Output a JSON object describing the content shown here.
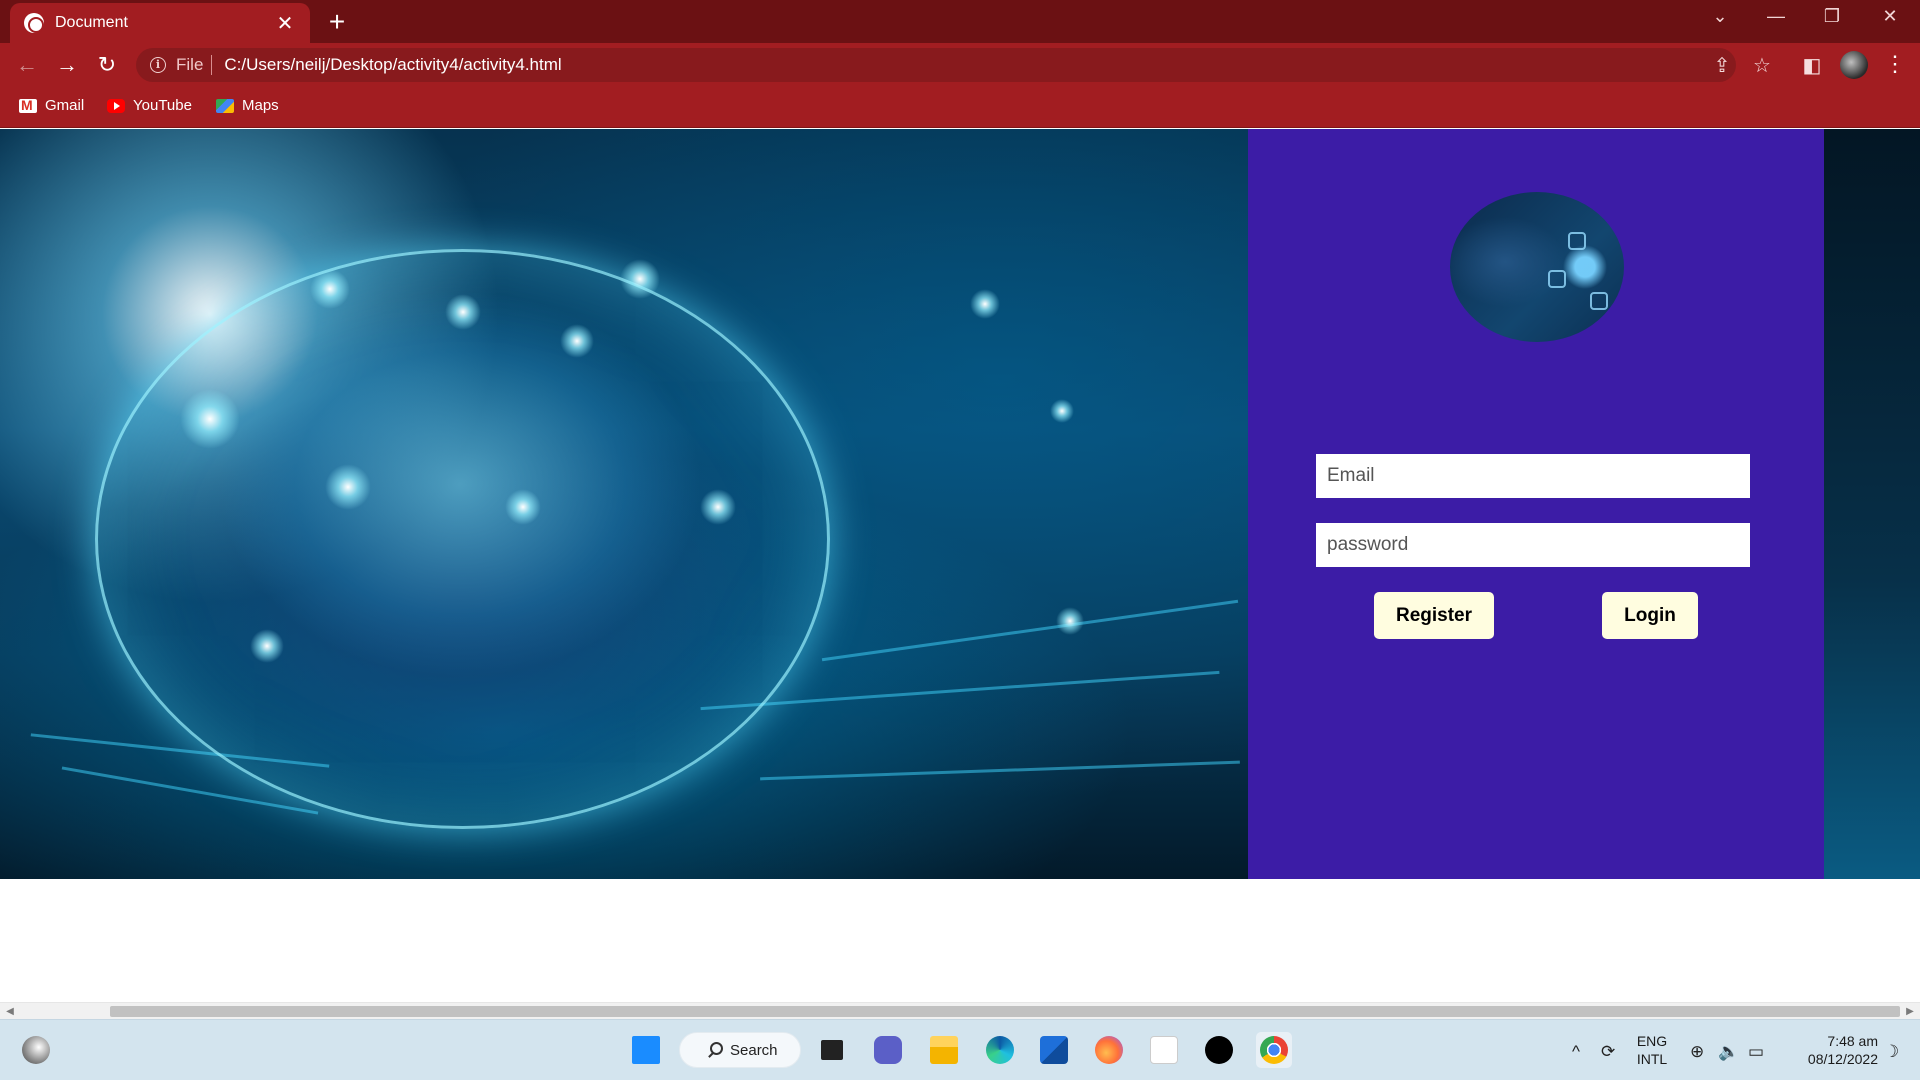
{
  "browser": {
    "tab_title": "Document",
    "tab_close": "✕",
    "new_tab": "+",
    "url_scheme": "File",
    "url": "C:/Users/neilj/Desktop/activity4/activity4.html",
    "bookmarks": [
      {
        "label": "Gmail",
        "icon": "gmail-icon"
      },
      {
        "label": "YouTube",
        "icon": "youtube-icon"
      },
      {
        "label": "Maps",
        "icon": "maps-icon"
      }
    ],
    "window_controls": {
      "tab_search": "⌄",
      "minimize": "—",
      "restore": "❐",
      "close": "✕"
    },
    "nav": {
      "back": "←",
      "forward": "→",
      "reload": "↻"
    },
    "omnibox_icons": {
      "info": "i",
      "share": "⇪",
      "star": "☆",
      "sidepanel": "◧",
      "menu": "⋮"
    }
  },
  "page": {
    "login": {
      "email_placeholder": "Email",
      "password_placeholder": "password",
      "register_label": "Register",
      "login_label": "Login"
    },
    "colors": {
      "panel": "#3c1ca6",
      "button": "#fffde0",
      "chrome": "#a21d21"
    }
  },
  "taskbar": {
    "search_label": "Search",
    "language_line1": "ENG",
    "language_line2": "INTL",
    "time": "7:48 am",
    "date": "08/12/2022",
    "tray": {
      "chevron": "^",
      "sync": "⟳",
      "globe": "⊕",
      "volume": "🔈",
      "battery": "▭",
      "moon": "☽"
    }
  }
}
